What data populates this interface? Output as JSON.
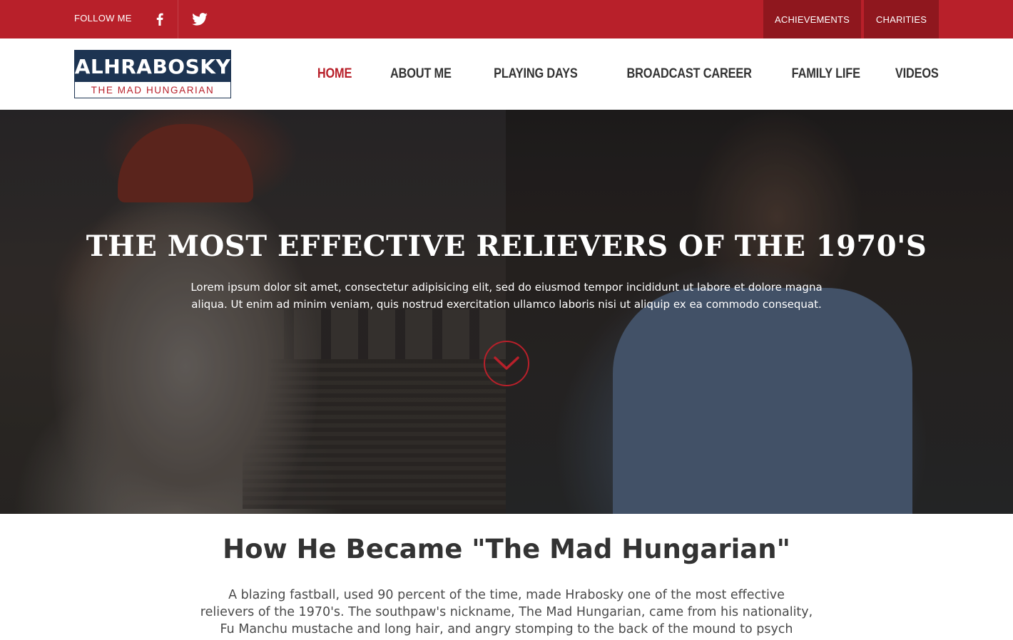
{
  "topbar": {
    "follow_label": "FOLLOW ME",
    "social": [
      {
        "icon": "facebook-icon"
      },
      {
        "icon": "twitter-icon"
      }
    ],
    "links": [
      "ACHIEVEMENTS",
      "CHARITIES"
    ]
  },
  "header": {
    "logo_title": "ALHRABOSKY",
    "logo_subtitle": "THE MAD HUNGARIAN",
    "nav": [
      "HOME",
      "ABOUT ME",
      "PLAYING DAYS",
      "BROADCAST CAREER",
      "FAMILY LIFE",
      "VIDEOS"
    ],
    "active_nav": "HOME"
  },
  "hero": {
    "title": "THE MOST EFFECTIVE RELIEVERS OF THE 1970'S",
    "text": "Lorem ipsum dolor sit amet, consectetur adipisicing elit, sed do eiusmod tempor incididunt ut labore et dolore magna aliqua. Ut enim ad minim veniam, quis nostrud exercitation ullamco laboris nisi ut aliquip ex ea commodo consequat.",
    "scroll_icon": "chevron-down-icon"
  },
  "section": {
    "title": "How He Became \"The Mad Hungarian\"",
    "text": "A blazing fastball, used 90 percent of the time, made Hrabosky one of the most effective relievers of the 1970's. The southpaw's nickname, The Mad Hungarian, came from his nationality, Fu Manchu mustache and long hair, and angry stomping to the back of the mound to psych"
  },
  "colors": {
    "brand_red": "#b8202a",
    "dark_red": "#8f171e",
    "navy": "#1d3452",
    "text_dark": "#333333"
  }
}
